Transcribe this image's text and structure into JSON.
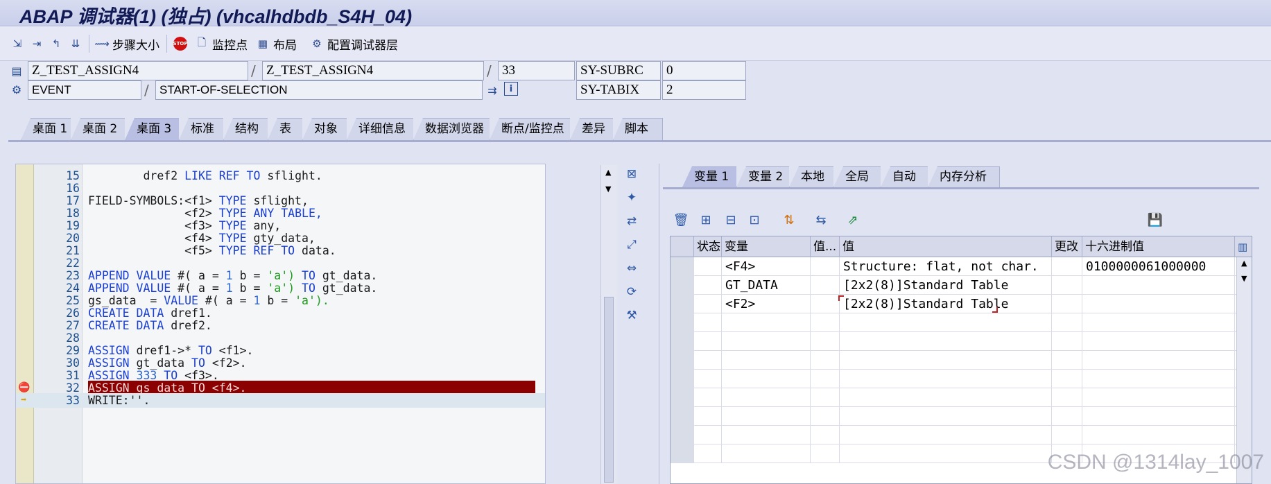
{
  "window": {
    "title": "ABAP 调试器(1) (独占) (vhcalhdbdb_S4H_04)"
  },
  "toolbar": {
    "step_size": "步骤大小",
    "watchpoint": "监控点",
    "layout": "布局",
    "config_layer": "配置调试器层"
  },
  "info": {
    "program": "Z_TEST_ASSIGN4",
    "include": "Z_TEST_ASSIGN4",
    "line": "33",
    "event_type": "EVENT",
    "event_name": "START-OF-SELECTION",
    "sys_field1": "SY-SUBRC",
    "sys_value1": "0",
    "sys_field2": "SY-TABIX",
    "sys_value2": "2"
  },
  "tabs": [
    "桌面 1",
    "桌面 2",
    "桌面 3",
    "标准",
    "结构",
    "表",
    "对象",
    "详细信息",
    "数据浏览器",
    "断点/监控点",
    "差异",
    "脚本"
  ],
  "code": {
    "lines": [
      {
        "n": "15",
        "t": "        dref2 LIKE REF TO sflight."
      },
      {
        "n": "16",
        "t": ""
      },
      {
        "n": "17",
        "t": "FIELD-SYMBOLS:<f1> TYPE sflight,"
      },
      {
        "n": "18",
        "t": "              <f2> TYPE ANY TABLE,"
      },
      {
        "n": "19",
        "t": "              <f3> TYPE any,"
      },
      {
        "n": "20",
        "t": "              <f4> TYPE gty_data,"
      },
      {
        "n": "21",
        "t": "              <f5> TYPE REF TO data."
      },
      {
        "n": "22",
        "t": ""
      },
      {
        "n": "23",
        "t": "APPEND VALUE #( a = 1 b = 'a') TO gt_data."
      },
      {
        "n": "24",
        "t": "APPEND VALUE #( a = 1 b = 'a') TO gt_data."
      },
      {
        "n": "25",
        "t": "gs_data  = VALUE #( a = 1 b = 'a')."
      },
      {
        "n": "26",
        "t": "CREATE DATA dref1."
      },
      {
        "n": "27",
        "t": "CREATE DATA dref2."
      },
      {
        "n": "28",
        "t": ""
      },
      {
        "n": "29",
        "t": "ASSIGN dref1->* TO <f1>."
      },
      {
        "n": "30",
        "t": "ASSIGN gt_data TO <f2>."
      },
      {
        "n": "31",
        "t": "ASSIGN 333 TO <f3>."
      },
      {
        "n": "32",
        "t": "ASSIGN gs_data TO <f4>."
      },
      {
        "n": "33",
        "t": "WRITE:''."
      }
    ]
  },
  "var_tabs": [
    "变量 1",
    "变量 2",
    "本地",
    "全局",
    "自动",
    "内存分析"
  ],
  "grid": {
    "headers": [
      "状态",
      "变量",
      "值...",
      "值",
      "更改",
      "十六进制值"
    ],
    "rows": [
      {
        "var": "<F4>",
        "val": "Structure: flat, not char.",
        "hex": "0100000061000000"
      },
      {
        "var": "GT_DATA",
        "val": "[2x2(8)]Standard Table",
        "hex": ""
      },
      {
        "var": "<F2>",
        "val": "[2x2(8)]Standard Table",
        "hex": ""
      }
    ]
  },
  "watermark": "CSDN @1314lay_1007"
}
